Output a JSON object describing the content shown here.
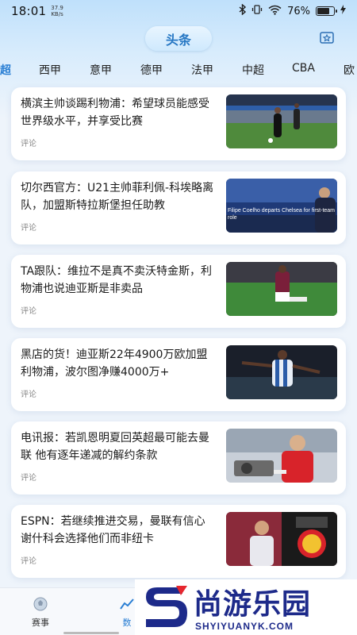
{
  "status_bar": {
    "time": "18:01",
    "net_speed_value": "37.9",
    "net_speed_unit": "KB/s",
    "battery_percent": "76%",
    "battery_level": 0.76
  },
  "header": {
    "title": "头条",
    "icon": "bookmark-star-icon"
  },
  "tabs": [
    {
      "label": "超"
    },
    {
      "label": "西甲"
    },
    {
      "label": "意甲"
    },
    {
      "label": "德甲"
    },
    {
      "label": "法甲"
    },
    {
      "label": "中超"
    },
    {
      "label": "CBA"
    },
    {
      "label": "欧"
    }
  ],
  "articles": [
    {
      "title": "横滨主帅谈踢利物浦：希望球员能感受世界级水平，并享受比赛",
      "comment_label": "评论",
      "thumb_text": ""
    },
    {
      "title": "切尔西官方：U21主帅菲利佩-科埃略离队，加盟斯特拉斯堡担任助教",
      "comment_label": "评论",
      "thumb_text": "Filipe Coelho departs Chelsea for first-team role"
    },
    {
      "title": "TA跟队：维拉不是真不卖沃特金斯，利物浦也说迪亚斯是非卖品",
      "comment_label": "评论",
      "thumb_text": ""
    },
    {
      "title": "黑店的货！迪亚斯22年4900万欧加盟利物浦，波尔图净赚4000万+",
      "comment_label": "评论",
      "thumb_text": ""
    },
    {
      "title": "电讯报：若凯恩明夏回英超最可能去曼联 他有逐年递减的解约条款",
      "comment_label": "评论",
      "thumb_text": ""
    },
    {
      "title": "ESPN：若继续推进交易，曼联有信心谢什科会选择他们而非纽卡",
      "comment_label": "评论",
      "thumb_text": ""
    }
  ],
  "bottom_nav": [
    {
      "label": "赛事",
      "icon": "ball-icon"
    },
    {
      "label": "数",
      "icon": "chart-icon"
    }
  ],
  "watermark": {
    "name": "尚游乐园",
    "domain": "SHYIYUANYK.COM"
  },
  "colors": {
    "accent": "#2a7fd4",
    "watermark": "#1d2a8a"
  }
}
